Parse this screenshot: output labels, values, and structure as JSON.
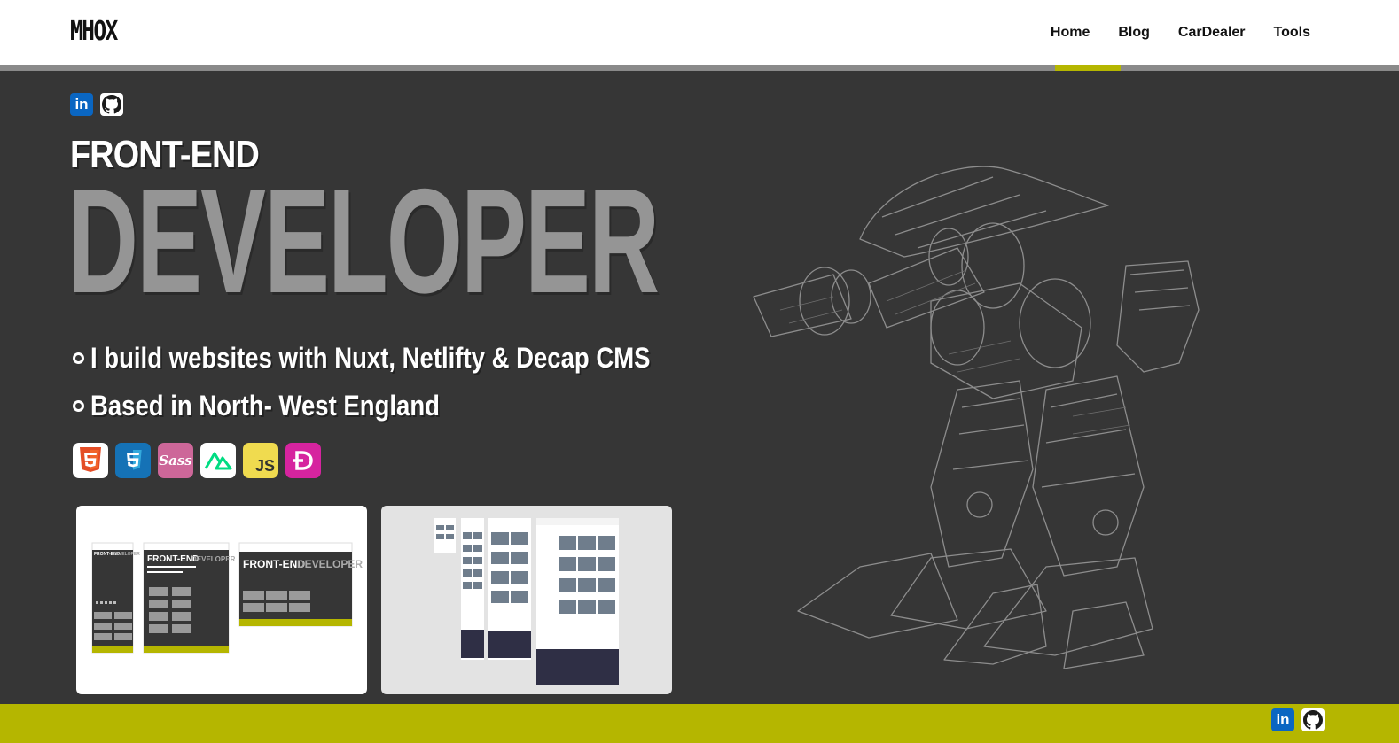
{
  "header": {
    "logo": "MHOX",
    "nav": [
      "Home",
      "Blog",
      "CarDealer",
      "Tools"
    ],
    "active": "Home"
  },
  "hero": {
    "line1": "FRONT-END",
    "line2": "DEVELOPER",
    "bullets": [
      "I build websites with Nuxt, Netlifty & Decap CMS",
      "Based in North- West England"
    ]
  },
  "social": [
    "linkedin-icon",
    "github-icon"
  ],
  "tech_icons": [
    "html5-icon",
    "css3-icon",
    "sass-icon",
    "nuxt-icon",
    "javascript-icon",
    "decap-icon"
  ],
  "tech_labels": {
    "sass": "Sass",
    "js": "JS"
  },
  "mini": {
    "front": "FRONT-END",
    "developer": "DEVELOPER"
  },
  "colors": {
    "background": "#363636",
    "accent": "#b5b600",
    "linkedin": "#0a66c2",
    "developer_text": "#959595"
  }
}
